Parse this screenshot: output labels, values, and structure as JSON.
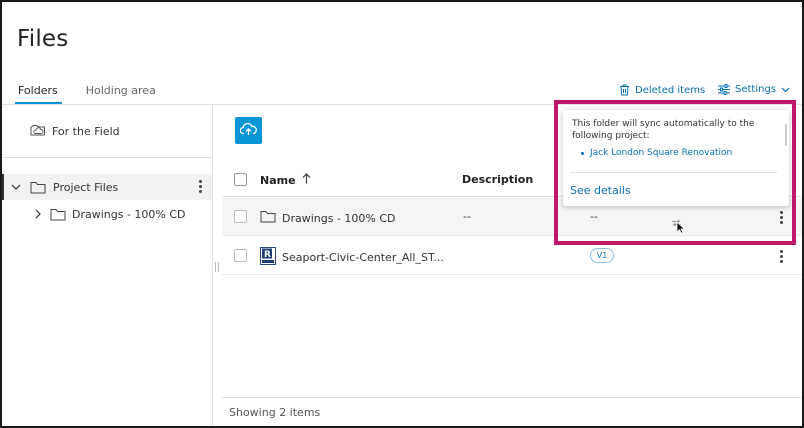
{
  "page": {
    "title": "Files"
  },
  "tabs": [
    {
      "label": "Folders",
      "active": true
    },
    {
      "label": "Holding area",
      "active": false
    }
  ],
  "toolbar": {
    "deleted_items_label": "Deleted items",
    "settings_label": "Settings"
  },
  "left_panel": {
    "field_label": "For the Field",
    "tree": [
      {
        "label": "Project Files",
        "expanded": true,
        "selected": true
      },
      {
        "label": "Drawings - 100% CD",
        "expanded": false,
        "selected": false
      }
    ]
  },
  "table": {
    "columns": {
      "name": "Name",
      "description": "Description"
    },
    "rows": [
      {
        "name": "Drawings - 100% CD",
        "description": "--",
        "version_col": "--"
      },
      {
        "name": "Seaport-Civic-Center_All_ST...",
        "description": "",
        "version": "V1"
      }
    ],
    "footer": "Showing 2 items"
  },
  "popup": {
    "text": "This folder will sync automatically to the following project:",
    "project": "Jack London Square Renovation",
    "link": "See details"
  },
  "colors": {
    "accent": "#0696d7",
    "highlight": "#c0186b",
    "link": "#0a6fb0"
  }
}
